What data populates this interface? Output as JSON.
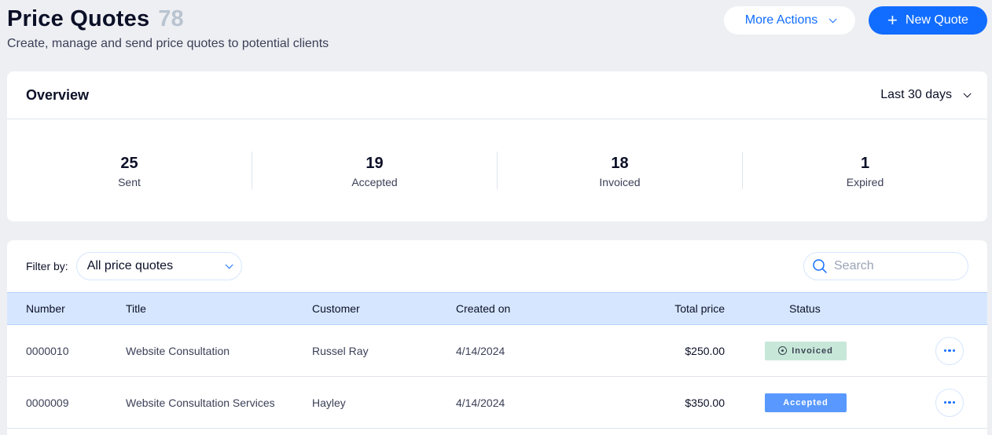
{
  "header": {
    "title": "Price Quotes",
    "count": "78",
    "subtitle": "Create, manage and send price quotes to potential clients",
    "more_actions_label": "More Actions",
    "new_quote_label": "New Quote"
  },
  "overview": {
    "title": "Overview",
    "range": "Last 30 days",
    "stats": [
      {
        "value": "25",
        "label": "Sent"
      },
      {
        "value": "19",
        "label": "Accepted"
      },
      {
        "value": "18",
        "label": "Invoiced"
      },
      {
        "value": "1",
        "label": "Expired"
      }
    ]
  },
  "table": {
    "filter_label": "Filter by:",
    "filter_value": "All price quotes",
    "search_placeholder": "Search",
    "columns": {
      "number": "Number",
      "title": "Title",
      "customer": "Customer",
      "created_on": "Created on",
      "total_price": "Total price",
      "status": "Status"
    },
    "rows": [
      {
        "number": "0000010",
        "title": "Website Consultation",
        "customer": "Russel Ray",
        "created_on": "4/14/2024",
        "total_price": "$250.00",
        "status": "Invoiced"
      },
      {
        "number": "0000009",
        "title": "Website Consultation Services",
        "customer": "Hayley",
        "created_on": "4/14/2024",
        "total_price": "$350.00",
        "status": "Accepted"
      }
    ]
  },
  "colors": {
    "accent": "#116dff",
    "invoiced_badge": "#c7e8d8",
    "accepted_badge": "#5999ff",
    "table_header": "#d6e6fe"
  }
}
